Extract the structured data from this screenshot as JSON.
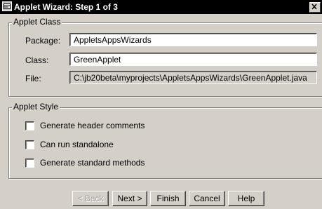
{
  "window": {
    "title": "Applet Wizard: Step 1 of 3",
    "icon": "applet-wizard-icon",
    "close_icon": "close-icon"
  },
  "applet_class": {
    "legend": "Applet Class",
    "package_label": "Package:",
    "package_value": "AppletsAppsWizards",
    "class_label": "Class:",
    "class_value": "GreenApplet",
    "file_label": "File:",
    "file_value": "C:\\jb20beta\\myprojects\\AppletsAppsWizards\\GreenApplet.java"
  },
  "applet_style": {
    "legend": "Applet Style",
    "options": [
      {
        "label": "Generate header comments",
        "checked": false
      },
      {
        "label": "Can run standalone",
        "checked": false
      },
      {
        "label": "Generate standard methods",
        "checked": false
      }
    ]
  },
  "buttons": {
    "back": "< Back",
    "next": "Next >",
    "finish": "Finish",
    "cancel": "Cancel",
    "help": "Help"
  },
  "colors": {
    "title_bar": "#000000",
    "face": "#d4d0c8"
  }
}
